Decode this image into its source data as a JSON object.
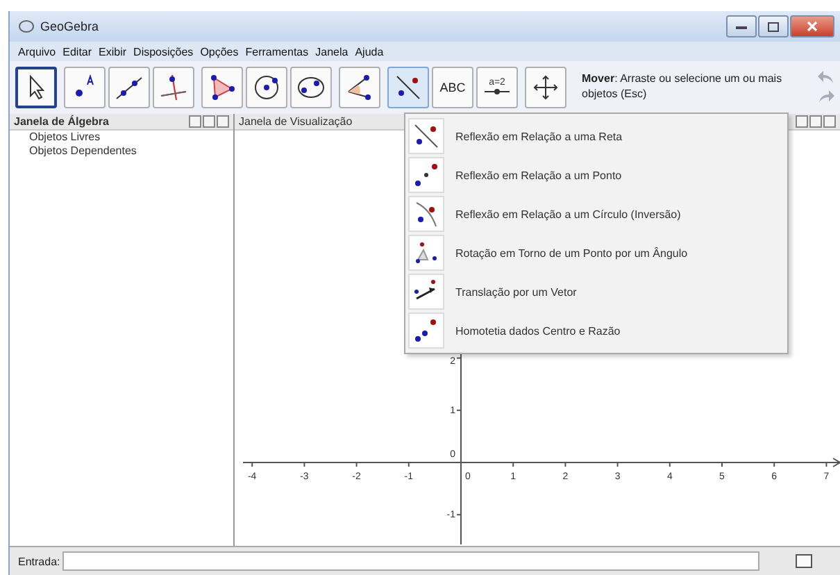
{
  "window": {
    "title": "GeoGebra"
  },
  "menu": [
    "Arquivo",
    "Editar",
    "Exibir",
    "Disposições",
    "Opções",
    "Ferramentas",
    "Janela",
    "Ajuda"
  ],
  "toolbar": {
    "groups": [
      [
        {
          "kind": "move",
          "selected": true,
          "open": false
        }
      ],
      [
        {
          "kind": "point",
          "selected": false,
          "open": false
        },
        {
          "kind": "line",
          "selected": false,
          "open": false
        },
        {
          "kind": "perpendicular",
          "selected": false,
          "open": false
        }
      ],
      [
        {
          "kind": "polygon",
          "selected": false,
          "open": false
        },
        {
          "kind": "circle",
          "selected": false,
          "open": false
        },
        {
          "kind": "conic",
          "selected": false,
          "open": false
        }
      ],
      [
        {
          "kind": "angle",
          "selected": false,
          "open": false
        }
      ],
      [
        {
          "kind": "reflect",
          "selected": false,
          "open": true
        },
        {
          "kind": "text",
          "label": "ABC",
          "selected": false,
          "open": false
        },
        {
          "kind": "slider",
          "label": "a=2",
          "selected": false,
          "open": false
        }
      ],
      [
        {
          "kind": "pan",
          "selected": false,
          "open": false
        }
      ]
    ],
    "help": "**Mover**: Arraste ou selecione um ou mais objetos (Esc)"
  },
  "algebra": {
    "title": "Janela de Álgebra",
    "items": [
      "Objetos Livres",
      "Objetos Dependentes"
    ]
  },
  "graphics": {
    "title": "Janela de Visualização",
    "x_labels": [
      "-4",
      "-3",
      "-2",
      "-1",
      "0",
      "1",
      "2",
      "3",
      "4",
      "5",
      "6",
      "7"
    ],
    "y_labels": [
      "2",
      "1",
      "0",
      "-1"
    ]
  },
  "popup": [
    {
      "kind": "reflect-line",
      "label": "Reflexão em Relação a uma Reta"
    },
    {
      "kind": "reflect-point",
      "label": "Reflexão em Relação a um Ponto"
    },
    {
      "kind": "reflect-circle",
      "label": "Reflexão em Relação a um Círculo (Inversão)"
    },
    {
      "kind": "rotate",
      "label": "Rotação em Torno de um Ponto por um Ângulo"
    },
    {
      "kind": "translate",
      "label": "Translação por um Vetor"
    },
    {
      "kind": "dilate",
      "label": "Homotetia dados Centro e Razão"
    }
  ],
  "input": {
    "label": "Entrada:"
  }
}
